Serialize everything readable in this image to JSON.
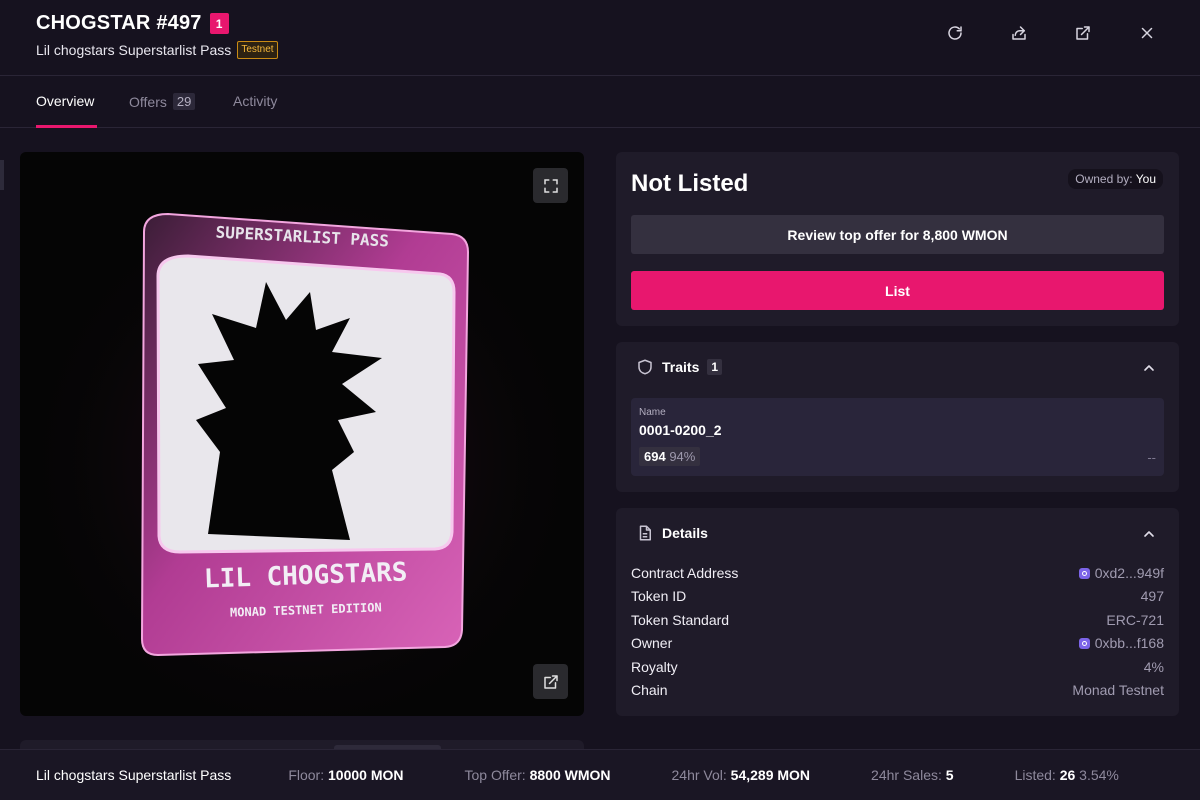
{
  "header": {
    "title": "CHOGSTAR #497",
    "rank": "1",
    "collection": "Lil chogstars Superstarlist Pass",
    "network_badge": "Testnet",
    "actions": [
      "refresh-icon",
      "share-icon",
      "external-link-icon",
      "close-icon"
    ]
  },
  "tabs": [
    {
      "label": "Overview",
      "active": true
    },
    {
      "label": "Offers",
      "count": "29"
    },
    {
      "label": "Activity"
    }
  ],
  "artwork": {
    "top_text": "SUPERSTARLIST PASS",
    "main_text": "LIL CHOGSTARS",
    "edition_text": "MONAD TESTNET EDITION"
  },
  "listing": {
    "status": "Not Listed",
    "owned_by_label": "Owned by:",
    "owned_by_value": "You",
    "review_button": "Review top offer for 8,800 WMON",
    "list_button": "List"
  },
  "traits": {
    "heading": "Traits",
    "count": "1",
    "items": [
      {
        "type": "Name",
        "value": "0001-0200_2",
        "count": "694",
        "percent": "94%",
        "price": "--"
      }
    ]
  },
  "details": {
    "heading": "Details",
    "rows": [
      {
        "label": "Contract Address",
        "value": "0xd2...949f"
      },
      {
        "label": "Token ID",
        "value": "497"
      },
      {
        "label": "Token Standard",
        "value": "ERC-721"
      },
      {
        "label": "Owner",
        "value": "0xbb...f168"
      },
      {
        "label": "Royalty",
        "value": "4%"
      },
      {
        "label": "Chain",
        "value": "Monad Testnet"
      }
    ]
  },
  "footer": {
    "collection": "Lil chogstars Superstarlist Pass",
    "floor_label": "Floor:",
    "floor_value": "10000 MON",
    "top_offer_label": "Top Offer:",
    "top_offer_value": "8800 WMON",
    "vol_label": "24hr Vol:",
    "vol_value": "54,289 MON",
    "sales_label": "24hr Sales:",
    "sales_value": "5",
    "listed_label": "Listed:",
    "listed_value": "26",
    "listed_pct": "3.54%"
  },
  "colors": {
    "accent": "#e8176e",
    "background": "#16121f",
    "panel": "#1f1b29",
    "testnet": "#f5b73b"
  }
}
